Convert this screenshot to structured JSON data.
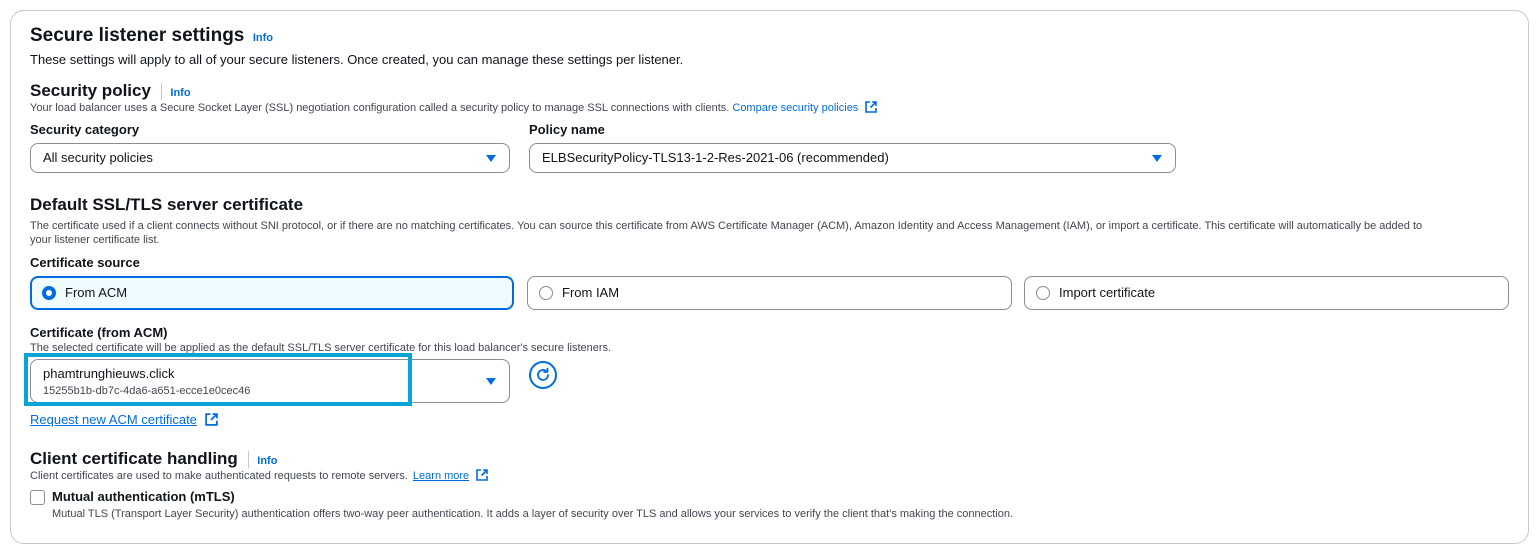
{
  "secure_listener": {
    "title": "Secure listener settings",
    "info": "Info",
    "description": "These settings will apply to all of your secure listeners. Once created, you can manage these settings per listener."
  },
  "security_policy": {
    "title": "Security policy",
    "info": "Info",
    "description": "Your load balancer uses a Secure Socket Layer (SSL) negotiation configuration called a security policy to manage SSL connections with clients.",
    "compare_link": "Compare security policies",
    "category_label": "Security category",
    "category_value": "All security policies",
    "policy_label": "Policy name",
    "policy_value": "ELBSecurityPolicy-TLS13-1-2-Res-2021-06 (recommended)"
  },
  "default_cert": {
    "title": "Default SSL/TLS server certificate",
    "description_line1": "The certificate used if a client connects without SNI protocol, or if there are no matching certificates. You can source this certificate from AWS Certificate Manager (ACM), Amazon Identity and Access Management (IAM), or import a certificate. This certificate will automatically be added to",
    "description_line2": "your listener certificate list.",
    "source_label": "Certificate source",
    "sources": [
      {
        "label": "From ACM",
        "selected": true
      },
      {
        "label": "From IAM",
        "selected": false
      },
      {
        "label": "Import certificate",
        "selected": false
      }
    ],
    "acm_label": "Certificate (from ACM)",
    "acm_description": "The selected certificate will be applied as the default SSL/TLS server certificate for this load balancer's secure listeners.",
    "cert_name": "phamtrunghieuws.click",
    "cert_id": "15255b1b-db7c-4da6-a651-ecce1e0cec46",
    "request_link": "Request new ACM certificate"
  },
  "client_cert": {
    "title": "Client certificate handling",
    "info": "Info",
    "description": "Client certificates are used to make authenticated requests to remote servers.",
    "learn_more": "Learn more",
    "mtls_label": "Mutual authentication (mTLS)",
    "mtls_checked": false,
    "mtls_description": "Mutual TLS (Transport Layer Security) authentication offers two-way peer authentication. It adds a layer of security over TLS and allows your services to verify the client that's making the connection."
  },
  "colors": {
    "accent": "#006ce0",
    "highlight": "#0aa3d6",
    "border": "#8c8c94"
  }
}
